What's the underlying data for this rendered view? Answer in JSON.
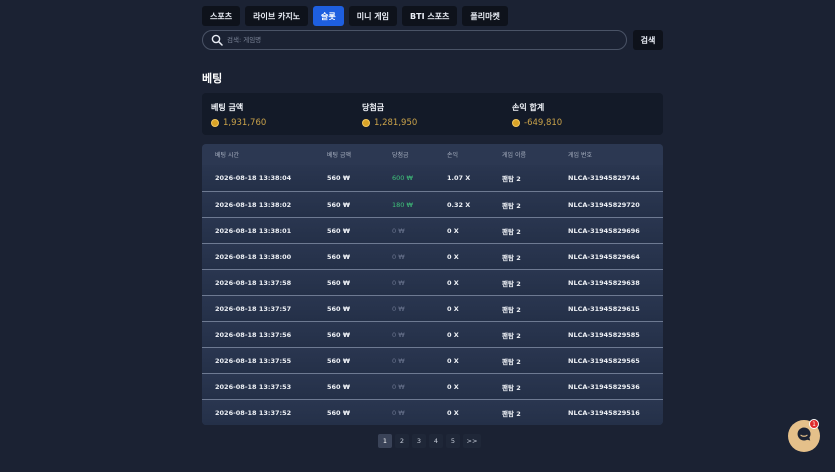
{
  "tabs": [
    "스포츠",
    "라이브 카지노",
    "슬롯",
    "미니 게임",
    "BTI 스포츠",
    "폴리마켓"
  ],
  "active_tab": 2,
  "search": {
    "placeholder": "검색: 게임명",
    "button": "검색"
  },
  "section_title": "베팅",
  "summary": [
    {
      "label": "베팅 금액",
      "value": "1,931,760"
    },
    {
      "label": "당첨금",
      "value": "1,281,950"
    },
    {
      "label": "손익 합계",
      "value": "-649,810"
    }
  ],
  "table": {
    "headers": [
      "베팅 시간",
      "베팅 금액",
      "당첨금",
      "손익",
      "게임 이름",
      "게임 번호"
    ],
    "rows": [
      [
        "2026-08-18 13:38:04",
        "560 ₩",
        "600 ₩",
        "1.07 X",
        "팬탐 2",
        "NLCA-31945829744"
      ],
      [
        "2026-08-18 13:38:02",
        "560 ₩",
        "180 ₩",
        "0.32 X",
        "팬탐 2",
        "NLCA-31945829720"
      ],
      [
        "2026-08-18 13:38:01",
        "560 ₩",
        "0 ₩",
        "0 X",
        "팬탐 2",
        "NLCA-31945829696"
      ],
      [
        "2026-08-18 13:38:00",
        "560 ₩",
        "0 ₩",
        "0 X",
        "팬탐 2",
        "NLCA-31945829664"
      ],
      [
        "2026-08-18 13:37:58",
        "560 ₩",
        "0 ₩",
        "0 X",
        "팬탐 2",
        "NLCA-31945829638"
      ],
      [
        "2026-08-18 13:37:57",
        "560 ₩",
        "0 ₩",
        "0 X",
        "팬탐 2",
        "NLCA-31945829615"
      ],
      [
        "2026-08-18 13:37:56",
        "560 ₩",
        "0 ₩",
        "0 X",
        "팬탐 2",
        "NLCA-31945829585"
      ],
      [
        "2026-08-18 13:37:55",
        "560 ₩",
        "0 ₩",
        "0 X",
        "팬탐 2",
        "NLCA-31945829565"
      ],
      [
        "2026-08-18 13:37:53",
        "560 ₩",
        "0 ₩",
        "0 X",
        "팬탐 2",
        "NLCA-31945829536"
      ],
      [
        "2026-08-18 13:37:52",
        "560 ₩",
        "0 ₩",
        "0 X",
        "팬탐 2",
        "NLCA-31945829516"
      ]
    ]
  },
  "pagination": {
    "pages": [
      "1",
      "2",
      "3",
      "4",
      "5"
    ],
    "active": "1",
    "next": ">>"
  },
  "chat": {
    "badge": "1",
    "icon": "chat-icon"
  },
  "colors": {
    "background": "#1b2233",
    "accent": "#1e5fe0",
    "coin": "#d9a326",
    "positive": "#3fc37a"
  }
}
